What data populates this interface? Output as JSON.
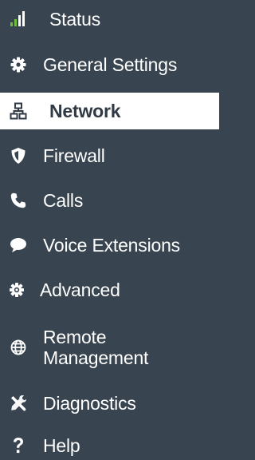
{
  "sidebar": {
    "items": [
      {
        "label": "Status",
        "icon": "signal-bars-icon"
      },
      {
        "label": "General Settings",
        "icon": "gear-icon"
      },
      {
        "label": "Network",
        "icon": "network-icon",
        "active": true
      },
      {
        "label": "Firewall",
        "icon": "shield-icon"
      },
      {
        "label": "Calls",
        "icon": "phone-icon"
      },
      {
        "label": "Voice Extensions",
        "icon": "speech-bubble-icon"
      },
      {
        "label": "Advanced",
        "icon": "cog-icon"
      },
      {
        "label": "Remote Management",
        "icon": "globe-icon"
      },
      {
        "label": "Diagnostics",
        "icon": "tools-icon"
      },
      {
        "label": "Help",
        "icon": "question-icon"
      }
    ]
  },
  "colors": {
    "background": "#38444f",
    "active_background": "#ffffff",
    "text": "#ffffff",
    "active_text": "#2f3a44",
    "status_accent": "#6dbf3b"
  }
}
